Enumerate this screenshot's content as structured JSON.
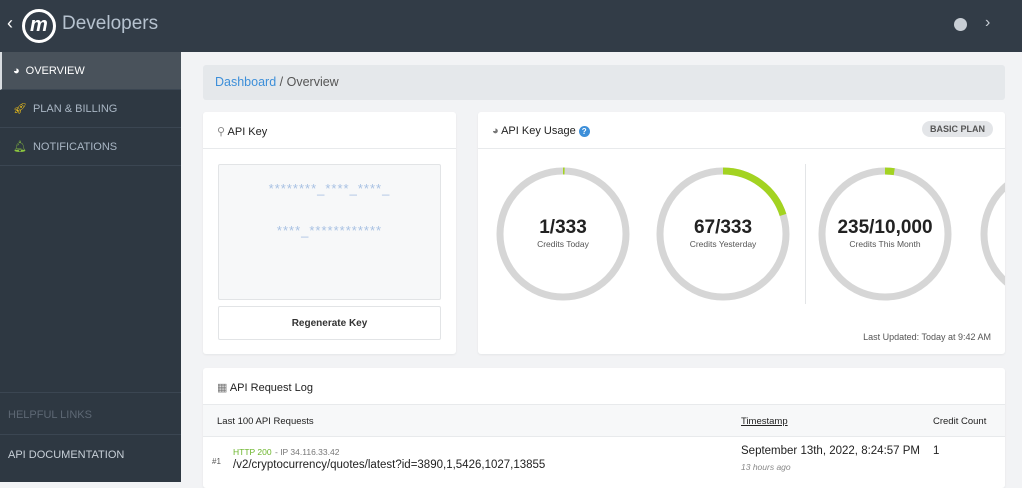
{
  "header": {
    "brand": "Developers",
    "back_icon": "chevron-left",
    "user_icon": "user-circle",
    "expand_icon": "chevron-right"
  },
  "sidebar": {
    "items": [
      {
        "label": "OVERVIEW",
        "icon": "dashboard",
        "icon_color": "#ffffff",
        "active": true
      },
      {
        "label": "PLAN & BILLING",
        "icon": "rocket",
        "icon_color": "#f5c518"
      },
      {
        "label": "NOTIFICATIONS",
        "icon": "bell",
        "icon_color": "#8cc63f"
      }
    ],
    "helpful_links": "HELPFUL LINKS",
    "api_documentation": "API DOCUMENTATION"
  },
  "breadcrumb": {
    "root": "Dashboard",
    "separator": "/",
    "current": "Overview"
  },
  "api_key": {
    "title": "API Key",
    "line1": "********_****_****_",
    "line2": "****_************",
    "regenerate": "Regenerate Key"
  },
  "usage": {
    "title": "API Key Usage",
    "plan": "BASIC PLAN",
    "accent": "#a3d321",
    "gauges": [
      {
        "value": "1/333",
        "label": "Credits Today",
        "fraction": 0.003
      },
      {
        "value": "67/333",
        "label": "Credits Yesterday",
        "fraction": 0.201
      },
      {
        "value": "235/10,000",
        "label": "Credits This Month",
        "fraction": 0.0235
      }
    ],
    "last_updated": "Last Updated: Today at 9:42 AM"
  },
  "log": {
    "title": "API Request Log",
    "columns": [
      "Last 100 API Requests",
      "Timestamp",
      "Credit Count"
    ],
    "rows": [
      {
        "index": "#1",
        "status": "HTTP 200",
        "ip": " - IP 34.116.33.42",
        "path": "/v2/cryptocurrency/quotes/latest?id=3890,1,5426,1027,13855",
        "timestamp": "September 13th, 2022, 8:24:57 PM",
        "ago": "13 hours ago",
        "credits": "1"
      }
    ]
  }
}
